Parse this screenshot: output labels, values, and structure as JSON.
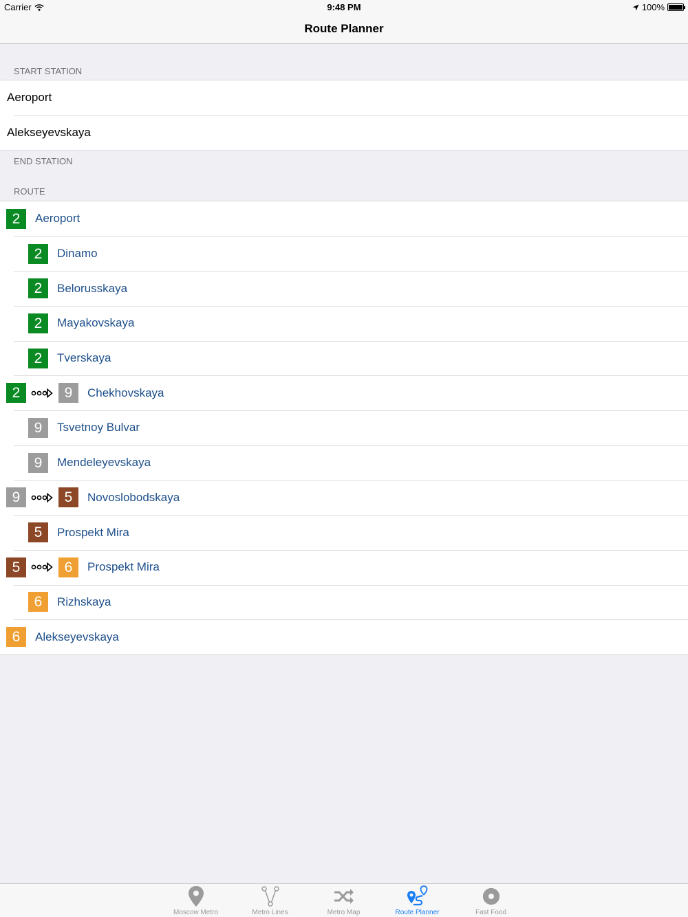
{
  "status_bar": {
    "carrier": "Carrier",
    "time": "9:48 PM",
    "battery": "100%"
  },
  "nav": {
    "title": "Route Planner"
  },
  "sections": {
    "start": "START STATION",
    "end": "END STATION",
    "route": "ROUTE"
  },
  "inputs": {
    "start_value": "Aeroport",
    "end_value": "Alekseyevskaya"
  },
  "line_colors": {
    "2": "#0a8a22",
    "9": "#9c9c9c",
    "5": "#8b4726",
    "6": "#f0a032"
  },
  "route": [
    {
      "line": "2",
      "station": "Aeroport"
    },
    {
      "line": "2",
      "station": "Dinamo"
    },
    {
      "line": "2",
      "station": "Belorusskaya"
    },
    {
      "line": "2",
      "station": "Mayakovskaya"
    },
    {
      "line": "2",
      "station": "Tverskaya"
    },
    {
      "from_line": "2",
      "line": "9",
      "station": "Chekhovskaya"
    },
    {
      "line": "9",
      "station": "Tsvetnoy Bulvar"
    },
    {
      "line": "9",
      "station": "Mendeleyevskaya"
    },
    {
      "from_line": "9",
      "line": "5",
      "station": "Novoslobodskaya"
    },
    {
      "line": "5",
      "station": "Prospekt Mira"
    },
    {
      "from_line": "5",
      "line": "6",
      "station": "Prospekt Mira"
    },
    {
      "line": "6",
      "station": "Rizhskaya"
    },
    {
      "line": "6",
      "station": "Alekseyevskaya"
    }
  ],
  "tabs": [
    {
      "label": "Moscow Metro",
      "icon": "map-pin-icon"
    },
    {
      "label": "Metro Lines",
      "icon": "metro-lines-icon"
    },
    {
      "label": "Metro Map",
      "icon": "shuffle-icon"
    },
    {
      "label": "Route Planner",
      "icon": "route-planner-icon",
      "active": true
    },
    {
      "label": "Fast Food",
      "icon": "gear-icon"
    }
  ]
}
